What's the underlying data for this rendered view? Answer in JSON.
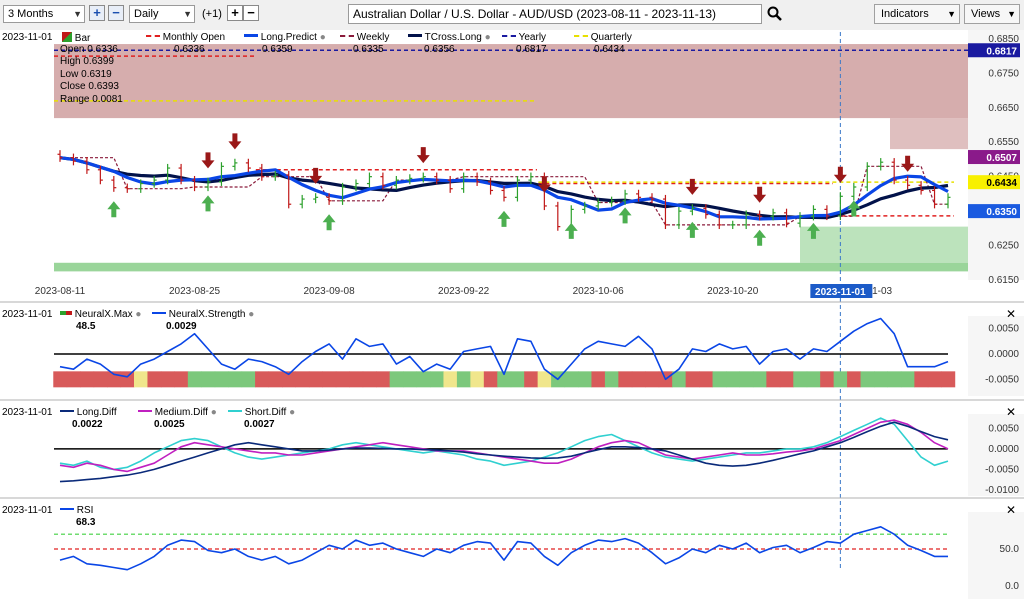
{
  "toolbar": {
    "range_value": "3 Months",
    "interval_value": "Daily",
    "interval_offset": "(+1)",
    "symbol_title": "Australian Dollar / U.S. Dollar - AUD/USD (2023-08-11 - 2023-11-13)",
    "indicators_label": "Indicators",
    "views_label": "Views"
  },
  "colors": {
    "candle_up": "#2ca02c",
    "candle_down": "#c01818",
    "long_predict": "#0a46e6",
    "tcross_long": "#02124a",
    "yearly": "#1a1aa0",
    "weekly": "#8a1a3a",
    "monthly_open": "#e02020",
    "quarterly": "#e8e000",
    "resistance_zone": "#c48a8a",
    "support_zone": "#8fd08f",
    "medium_diff": "#c020c0",
    "short_diff": "#30d0d0"
  },
  "icons": [
    "plus-icon",
    "minus-icon",
    "search-icon",
    "chevron-down-icon",
    "close-icon",
    "arrow-up-icon",
    "arrow-down-icon"
  ],
  "main": {
    "date": "2023-11-01",
    "legend": [
      "Bar",
      "Monthly Open",
      "Long.Predict",
      "Weekly",
      "TCross.Long",
      "Yearly",
      "Quarterly"
    ],
    "legend_values": [
      "0.6336",
      "0.6359",
      "0.6335",
      "0.6356",
      "0.6817",
      "0.6434"
    ],
    "ohlc": {
      "open_label": "Open",
      "open": "0.6336",
      "high_label": "High",
      "high": "0.6399",
      "low_label": "Low",
      "low": "0.6319",
      "close_label": "Close",
      "close": "0.6393",
      "range_label": "Range",
      "range": "0.0081"
    },
    "price_ticks": [
      "0.6850",
      "0.6750",
      "0.6650",
      "0.6550",
      "0.6450",
      "0.6350",
      "0.6250",
      "0.6150"
    ],
    "price_tags": [
      "0.6817",
      "0.6507",
      "0.6434",
      "0.6350"
    ],
    "date_ticks": [
      "2023-08-11",
      "2023-08-25",
      "2023-09-08",
      "2023-09-22",
      "2023-10-06",
      "2023-10-20",
      "11-03"
    ],
    "cursor_date": "2023-11-01"
  },
  "panels": {
    "neural": {
      "date": "2023-11-01",
      "legend": [
        "NeuralX.Max",
        "NeuralX.Strength"
      ],
      "values": [
        "48.5",
        "0.0029"
      ],
      "ticks": [
        "0.0050",
        "0.0000",
        "-0.0050"
      ]
    },
    "diff": {
      "date": "2023-11-01",
      "legend": [
        "Long.Diff",
        "Medium.Diff",
        "Short.Diff"
      ],
      "values": [
        "0.0022",
        "0.0025",
        "0.0027"
      ],
      "ticks": [
        "0.0050",
        "0.0000",
        "-0.0050",
        "-0.0100"
      ]
    },
    "rsi": {
      "date": "2023-11-01",
      "legend": [
        "RSI"
      ],
      "values": [
        "68.3"
      ],
      "ticks": [
        "50.0",
        "0.0"
      ]
    }
  },
  "chart_data": [
    {
      "type": "candlestick",
      "title": "Australian Dollar / U.S. Dollar - AUD/USD (2023-08-11 - 2023-11-13)",
      "x": [
        "2023-08-11",
        "2023-08-14",
        "2023-08-15",
        "2023-08-16",
        "2023-08-17",
        "2023-08-18",
        "2023-08-21",
        "2023-08-22",
        "2023-08-23",
        "2023-08-24",
        "2023-08-25",
        "2023-08-28",
        "2023-08-29",
        "2023-08-30",
        "2023-08-31",
        "2023-09-01",
        "2023-09-04",
        "2023-09-05",
        "2023-09-06",
        "2023-09-07",
        "2023-09-08",
        "2023-09-11",
        "2023-09-12",
        "2023-09-13",
        "2023-09-14",
        "2023-09-15",
        "2023-09-18",
        "2023-09-19",
        "2023-09-20",
        "2023-09-21",
        "2023-09-22",
        "2023-09-25",
        "2023-09-26",
        "2023-09-27",
        "2023-09-28",
        "2023-09-29",
        "2023-10-02",
        "2023-10-03",
        "2023-10-04",
        "2023-10-05",
        "2023-10-06",
        "2023-10-09",
        "2023-10-10",
        "2023-10-11",
        "2023-10-12",
        "2023-10-13",
        "2023-10-16",
        "2023-10-17",
        "2023-10-18",
        "2023-10-19",
        "2023-10-20",
        "2023-10-23",
        "2023-10-24",
        "2023-10-25",
        "2023-10-26",
        "2023-10-27",
        "2023-10-30",
        "2023-10-31",
        "2023-11-01",
        "2023-11-02",
        "2023-11-03",
        "2023-11-06",
        "2023-11-07",
        "2023-11-08",
        "2023-11-09",
        "2023-11-10",
        "2023-11-13"
      ],
      "close": [
        0.6505,
        0.6495,
        0.647,
        0.644,
        0.6418,
        0.6415,
        0.643,
        0.644,
        0.6475,
        0.644,
        0.642,
        0.6435,
        0.648,
        0.649,
        0.6475,
        0.645,
        0.6455,
        0.637,
        0.6385,
        0.639,
        0.638,
        0.642,
        0.643,
        0.645,
        0.6425,
        0.644,
        0.6445,
        0.645,
        0.644,
        0.6415,
        0.645,
        0.6435,
        0.641,
        0.639,
        0.644,
        0.645,
        0.6365,
        0.6305,
        0.6355,
        0.6365,
        0.6375,
        0.638,
        0.64,
        0.639,
        0.6385,
        0.631,
        0.635,
        0.6358,
        0.634,
        0.631,
        0.631,
        0.634,
        0.6335,
        0.6345,
        0.6315,
        0.6335,
        0.6355,
        0.6336,
        0.6393,
        0.642,
        0.648,
        0.6492,
        0.644,
        0.6425,
        0.641,
        0.637,
        0.639
      ],
      "monthly_open": [
        [
          0.68,
          "2023-08-11",
          "2023-08-31"
        ],
        [
          0.647,
          "2023-09-01",
          "2023-09-29"
        ],
        [
          0.643,
          "2023-10-02",
          "2023-10-31"
        ],
        [
          0.6336,
          "2023-11-01",
          "2023-11-13"
        ]
      ],
      "quarterly": [
        [
          0.667,
          "2023-08-11",
          "2023-09-29"
        ],
        [
          0.6434,
          "2023-10-02",
          "2023-11-13"
        ]
      ],
      "yearly": 0.6817,
      "price_range": [
        0.615,
        0.687
      ]
    },
    {
      "type": "line",
      "name": "NeuralX.Strength",
      "values": [
        -0.0025,
        -0.003,
        -0.001,
        -0.002,
        -0.004,
        -0.0045,
        -0.002,
        -0.001,
        0.0005,
        0.002,
        0.004,
        0.001,
        -0.002,
        -0.003,
        -0.001,
        -0.0015,
        -0.0025,
        -0.004,
        -0.0015,
        0.0005,
        0.002,
        -0.001,
        0.003,
        0.0015,
        0.002,
        -0.002,
        -0.0005,
        -0.0035,
        -0.002,
        -0.003,
        0.0005,
        0.001,
        0.0015,
        -0.004,
        0.003,
        0.0025,
        -0.003,
        -0.005,
        -0.002,
        0.001,
        0.0025,
        0.002,
        0.0015,
        0.0035,
        0.001,
        -0.005,
        -0.003,
        0.001,
        0.0005,
        0.002,
        0.001,
        0.0015,
        -0.002,
        0.0005,
        0.001,
        -0.001,
        0.001,
        0.0005,
        0.0025,
        0.0045,
        0.006,
        0.007,
        0.004,
        -0.0025,
        -0.0025,
        -0.0025,
        -0.0015
      ],
      "ylim": [
        -0.0075,
        0.0075
      ]
    },
    {
      "type": "line",
      "name": "Long.Diff",
      "values": [
        -0.008,
        -0.0078,
        -0.0075,
        -0.0072,
        -0.0068,
        -0.0064,
        -0.0058,
        -0.005,
        -0.004,
        -0.003,
        -0.002,
        -0.001,
        0.0,
        0.001,
        0.0015,
        0.001,
        0.0005,
        0.0,
        -0.0005,
        -0.0005,
        -0.0003,
        0.0,
        0.0002,
        0.0002,
        0.0001,
        0.0,
        0.0,
        -0.0002,
        -0.0003,
        -0.0005,
        -0.0008,
        -0.0012,
        -0.0015,
        -0.0018,
        -0.002,
        -0.0022,
        -0.0023,
        -0.0022,
        -0.0018,
        -0.001,
        -0.0002,
        0.0005,
        0.0005,
        0.0003,
        0.0,
        -0.0005,
        -0.0015,
        -0.0025,
        -0.0035,
        -0.004,
        -0.0042,
        -0.004,
        -0.0035,
        -0.0028,
        -0.002,
        -0.0012,
        -0.0005,
        0.0005,
        0.0015,
        0.0028,
        0.0042,
        0.0055,
        0.0065,
        0.0055,
        0.0042,
        0.003,
        0.0022
      ],
      "ylim": [
        -0.0115,
        0.0085
      ]
    },
    {
      "type": "line",
      "name": "Medium.Diff",
      "values": [
        -0.004,
        -0.0045,
        -0.0035,
        -0.004,
        -0.005,
        -0.0055,
        -0.0045,
        -0.0035,
        -0.0015,
        0.0005,
        0.0015,
        0.001,
        0.0005,
        0.0,
        -0.0005,
        -0.001,
        -0.001,
        -0.0015,
        -0.0015,
        -0.001,
        -0.0005,
        0.0,
        0.0005,
        0.001,
        0.0015,
        0.001,
        0.0005,
        0.0,
        -0.0005,
        -0.0005,
        -0.0005,
        -0.001,
        -0.0015,
        -0.002,
        -0.0025,
        -0.003,
        -0.0035,
        -0.0035,
        -0.0025,
        -0.001,
        0.0005,
        0.0015,
        0.002,
        0.0015,
        0.0,
        -0.0015,
        -0.002,
        -0.0025,
        -0.002,
        -0.0015,
        -0.001,
        -0.0015,
        -0.0015,
        -0.0012,
        -0.0008,
        -0.0005,
        0.0,
        0.001,
        0.002,
        0.0035,
        0.005,
        0.0065,
        0.007,
        0.006,
        0.004,
        0.0015,
        0.0
      ],
      "ylim": [
        -0.0115,
        0.0085
      ]
    },
    {
      "type": "line",
      "name": "Short.Diff",
      "values": [
        -0.0035,
        -0.004,
        -0.003,
        -0.0045,
        -0.005,
        -0.0045,
        -0.003,
        -0.001,
        0.0005,
        0.002,
        0.0025,
        0.002,
        0.0005,
        -0.001,
        -0.002,
        -0.0025,
        -0.002,
        -0.0015,
        -0.001,
        -0.0005,
        0.0,
        0.001,
        0.0015,
        0.001,
        0.0005,
        0.0,
        -0.0005,
        -0.001,
        -0.0005,
        -0.001,
        -0.0015,
        -0.0025,
        -0.003,
        -0.004,
        -0.0035,
        -0.003,
        -0.002,
        -0.001,
        0.0005,
        0.002,
        0.003,
        0.0035,
        0.002,
        0.0005,
        -0.001,
        -0.002,
        -0.0025,
        -0.003,
        -0.0025,
        -0.002,
        -0.0015,
        -0.001,
        -0.001,
        -0.0005,
        0.0,
        0.0,
        0.0005,
        0.0015,
        0.003,
        0.0045,
        0.006,
        0.0075,
        0.006,
        0.002,
        -0.002,
        -0.004,
        -0.003
      ],
      "ylim": [
        -0.0115,
        0.0085
      ]
    },
    {
      "type": "line",
      "name": "RSI",
      "values": [
        35,
        40,
        30,
        28,
        25,
        22,
        30,
        40,
        55,
        62,
        60,
        48,
        45,
        50,
        40,
        35,
        40,
        30,
        35,
        45,
        55,
        50,
        62,
        55,
        58,
        50,
        45,
        40,
        50,
        45,
        55,
        60,
        58,
        35,
        60,
        58,
        40,
        28,
        45,
        55,
        62,
        60,
        64,
        58,
        45,
        30,
        38,
        50,
        45,
        55,
        50,
        58,
        45,
        52,
        55,
        45,
        52,
        60,
        58,
        70,
        75,
        80,
        70,
        55,
        48,
        40,
        40
      ],
      "ylim": [
        0,
        100
      ],
      "levels": [
        70,
        50,
        30
      ]
    }
  ]
}
